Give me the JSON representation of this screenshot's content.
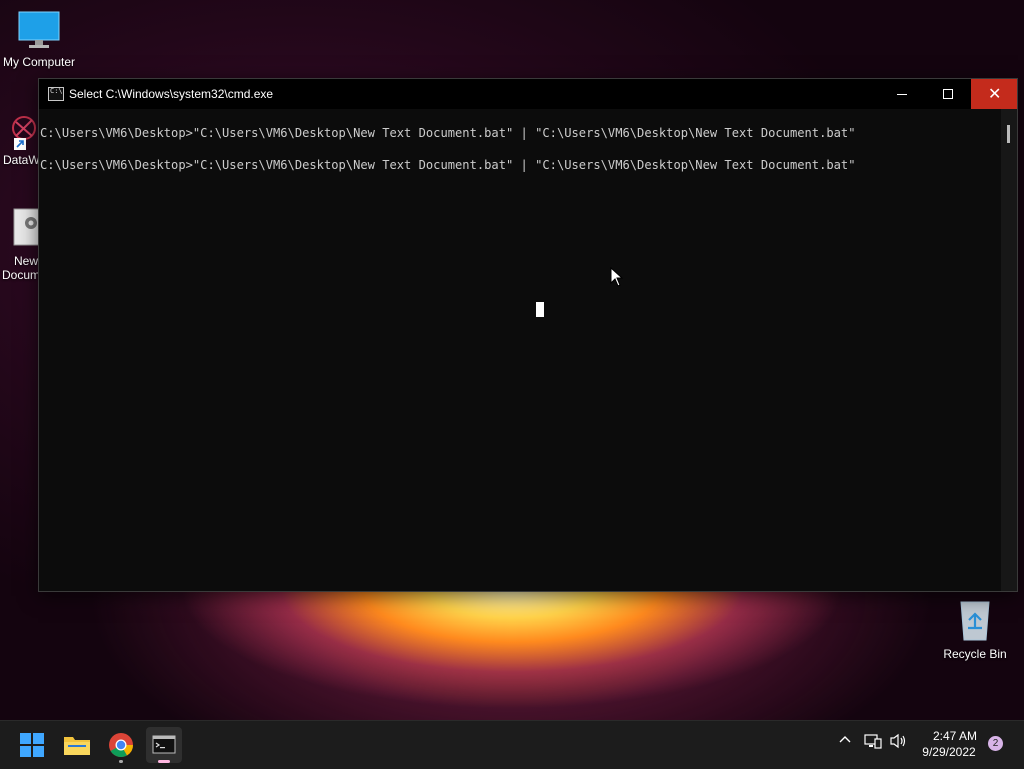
{
  "desktop": {
    "icons": [
      {
        "label": "My Computer"
      },
      {
        "label": "DataW"
      },
      {
        "label_line1": "New",
        "label_line2": "Docum"
      },
      {
        "label": "Recycle Bin"
      }
    ]
  },
  "window": {
    "title": "Select C:\\Windows\\system32\\cmd.exe",
    "icon_text": "C:\\",
    "console_lines": [
      "C:\\Users\\VM6\\Desktop>\"C:\\Users\\VM6\\Desktop\\New Text Document.bat\" | \"C:\\Users\\VM6\\Desktop\\New Text Document.bat\"",
      "C:\\Users\\VM6\\Desktop>\"C:\\Users\\VM6\\Desktop\\New Text Document.bat\" | \"C:\\Users\\VM6\\Desktop\\New Text Document.bat\""
    ]
  },
  "taskbar": {
    "time": "2:47 AM",
    "date": "9/29/2022",
    "notification_count": "2",
    "apps": [
      "start-button",
      "file-explorer",
      "chrome",
      "cmd"
    ]
  },
  "colors": {
    "close_button": "#c42b1c",
    "console_bg": "#0c0c0c",
    "console_text": "#cccccc",
    "taskbar_bg": "#1c1c1c"
  }
}
